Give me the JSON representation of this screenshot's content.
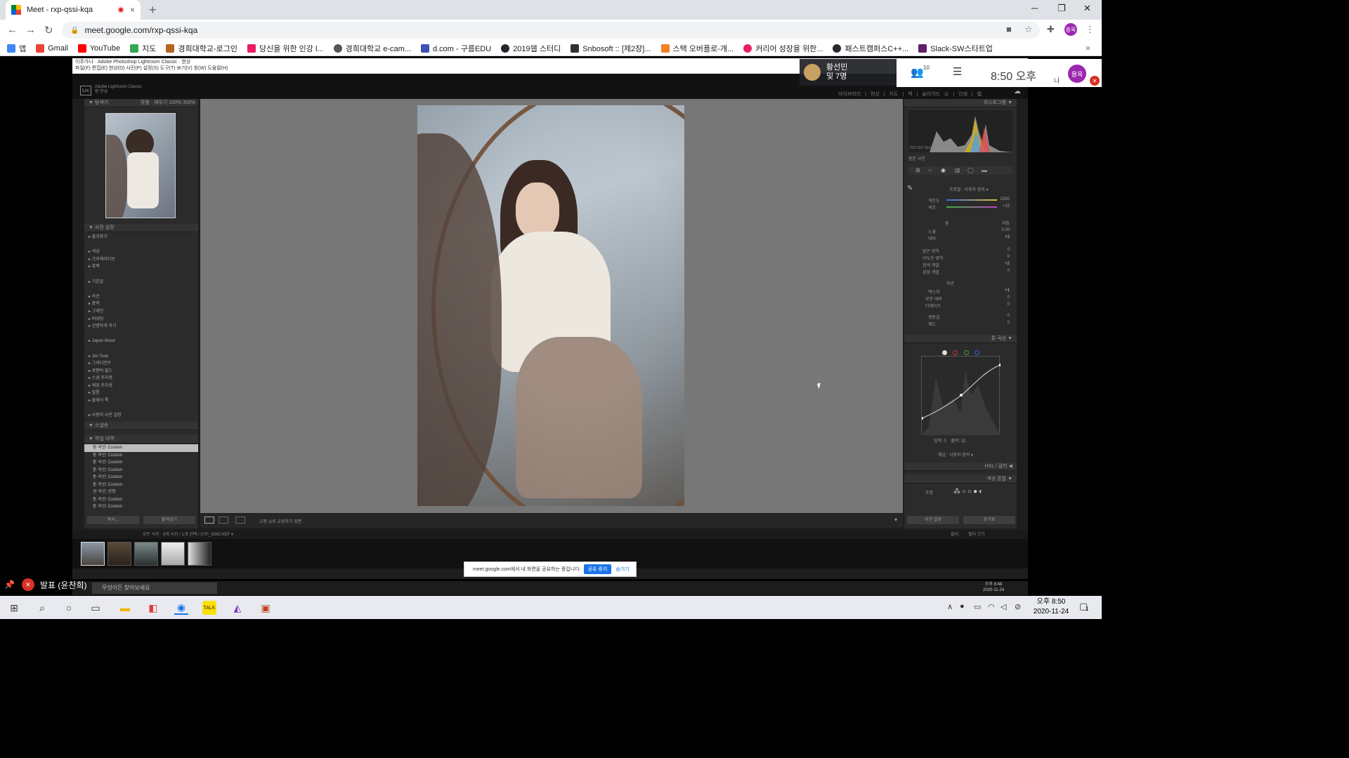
{
  "browser": {
    "tab_title": "Meet - rxp-qssi-kqa",
    "tab_close": "×",
    "new_tab": "+",
    "url": "meet.google.com/rxp-qssi-kqa",
    "bookmarks": [
      {
        "label": "앱",
        "color": "#4285f4"
      },
      {
        "label": "Gmail",
        "color": "#ea4335"
      },
      {
        "label": "YouTube",
        "color": "#ff0000"
      },
      {
        "label": "지도",
        "color": "#34a853"
      },
      {
        "label": "경희대학교-로그인",
        "color": "#b5651d"
      },
      {
        "label": "당신을 위한 인강 l...",
        "color": "#e91e63"
      },
      {
        "label": "경희대학교 e-cam...",
        "color": "#555555"
      },
      {
        "label": "d.com - 구름EDU",
        "color": "#3f51b5"
      },
      {
        "label": "2019웹 스터디",
        "color": "#24292e"
      },
      {
        "label": "Snbosoft :: [제2장]...",
        "color": "#333333"
      },
      {
        "label": "스택 오버플로-개...",
        "color": "#f48024"
      },
      {
        "label": "커리어 성장을 위한...",
        "color": "#e91e63"
      },
      {
        "label": "패스트캠퍼스C++...",
        "color": "#24292e"
      },
      {
        "label": "Slack-SW스타트업",
        "color": "#611f69"
      }
    ],
    "bookmarks_overflow": "»",
    "profile_initial": "용욱"
  },
  "lightroom": {
    "menu_line1": "이주가나 · Adobe Photoshop Lightroom Classic · 현상",
    "menu_line2": "파일(F)  편집(E)  현상(D)  사진(P)  설정(S)  도구(T)  보기(V)  창(W)  도움말(H)",
    "logo": "Lrc",
    "app_title": "Adobe Lightroom Classic",
    "user_name": "용 한성",
    "modules": "라이브러리 | 현상 | 지도 | 책 | 슬라이드 쇼 | 인쇄 | 웹",
    "navigator_header": "▼ 탐색기",
    "navigator_zoom": "맞춤 ·  채우기   100%   300%",
    "presets_header": "▼ 사전 설정",
    "presets": [
      "▸ 즐겨찾기",
      "",
      "▸ 색상",
      "▸ 크리에이티브",
      "▸ 흑백",
      "",
      "▸ 기본값",
      "",
      "▸ 곡선",
      "▸ 광학",
      "▸ 그레인",
      "▸ 비네팅",
      "▸ 선명하게 하기",
      "",
      "▸ Japan Mood",
      "",
      "▸ Jini Tone",
      "▸ 그라디언트",
      "▸ 로맨틱 필드",
      "▸ 스냅 프리셋",
      "▸ 웨딩 프리셋",
      "▸ 필름",
      "▸ 클래식 룩",
      "",
      "▸ 사용자 사전 설정"
    ],
    "snapshots_header": "▼ 스냅숏",
    "history_header": "▼ 작업 내역",
    "history": [
      "톤 곡선: Custom",
      "톤 곡선: Custom",
      "톤 곡선: Custom",
      "톤 곡선: Custom",
      "톤 곡선: Custom",
      "톤 곡선: Custom",
      "선 곡선: 선형",
      "톤 곡선: Custom",
      "톤 곡선: Custom"
    ],
    "copy_button": "복사...",
    "paste_button": "붙여넣기",
    "histogram_header": "히스토그램 ▼",
    "hist_readout": "ISO 125      70mm      f/1.8      1/160초",
    "original_photo": "원본 사진",
    "basic_profile": "프로필 : 사용자 정의 ▾",
    "temp_label": "색온도",
    "temp_value": "2350",
    "tint_label": "색조",
    "tint_value": "+15",
    "tone_label": "톤",
    "auto_label": "자동",
    "exposure_label": "노출",
    "exposure_value": "0.00",
    "contrast_label": "대비",
    "contrast_value": "+2",
    "highlights_label": "밝은 영역",
    "shadows_label": "어두운 영역",
    "whites_label": "흰색 계열",
    "whites_value": "+2",
    "blacks_label": "검정 계열",
    "presence_label": "외관",
    "texture_label": "텍스처",
    "texture_value": "+1",
    "clarity_label": "부분 대비",
    "dehaze_label": "디헤이즈",
    "vibrance_label": "생동감",
    "saturation_label": "채도",
    "zero": "0",
    "tone_curve_header": "톤 곡선 ▼",
    "curve_input": "입력:",
    "curve_input_value": "0",
    "curve_output": "출력:",
    "curve_output_value": "32",
    "channel_label": "채널 :",
    "channel_value": "사용자 정의 ▾",
    "hsl_header": "HSL / 컬러 ◀",
    "color_grading_header": "색상 혼합 ▼",
    "color_grading_sub": "조정",
    "prev_button": "이전 설정",
    "reset_button": "초기화",
    "toolbar_softproof": "교정 쇼로 교정하기 화면",
    "bottom_path": "모든 사진 · 6개 사진 / 1개 선택 / STP_3365.NEF ▾",
    "filter_label": "필터:",
    "filter_value": "필터 끄기"
  },
  "share_bar": {
    "text": "meet.google.com에서 내 화면을 공유하는 중입니다.",
    "stop_label": "공유 중지",
    "hide_label": "숨기기"
  },
  "inner_taskbar": {
    "search": "무엇이든 찾아보세요",
    "time": "오후 8:48",
    "date": "2020-11-24"
  },
  "meet": {
    "presenter_name": "황선민",
    "presenter_others": "및 7명",
    "people_count": "10",
    "clock": "8:50 오후",
    "me_label": "나",
    "me_initial": "용욱",
    "presentation_label": "발표 (윤찬희)"
  },
  "taskbar": {
    "time": "오후 8:50",
    "date": "2020-11-24",
    "notif_count": "1"
  }
}
